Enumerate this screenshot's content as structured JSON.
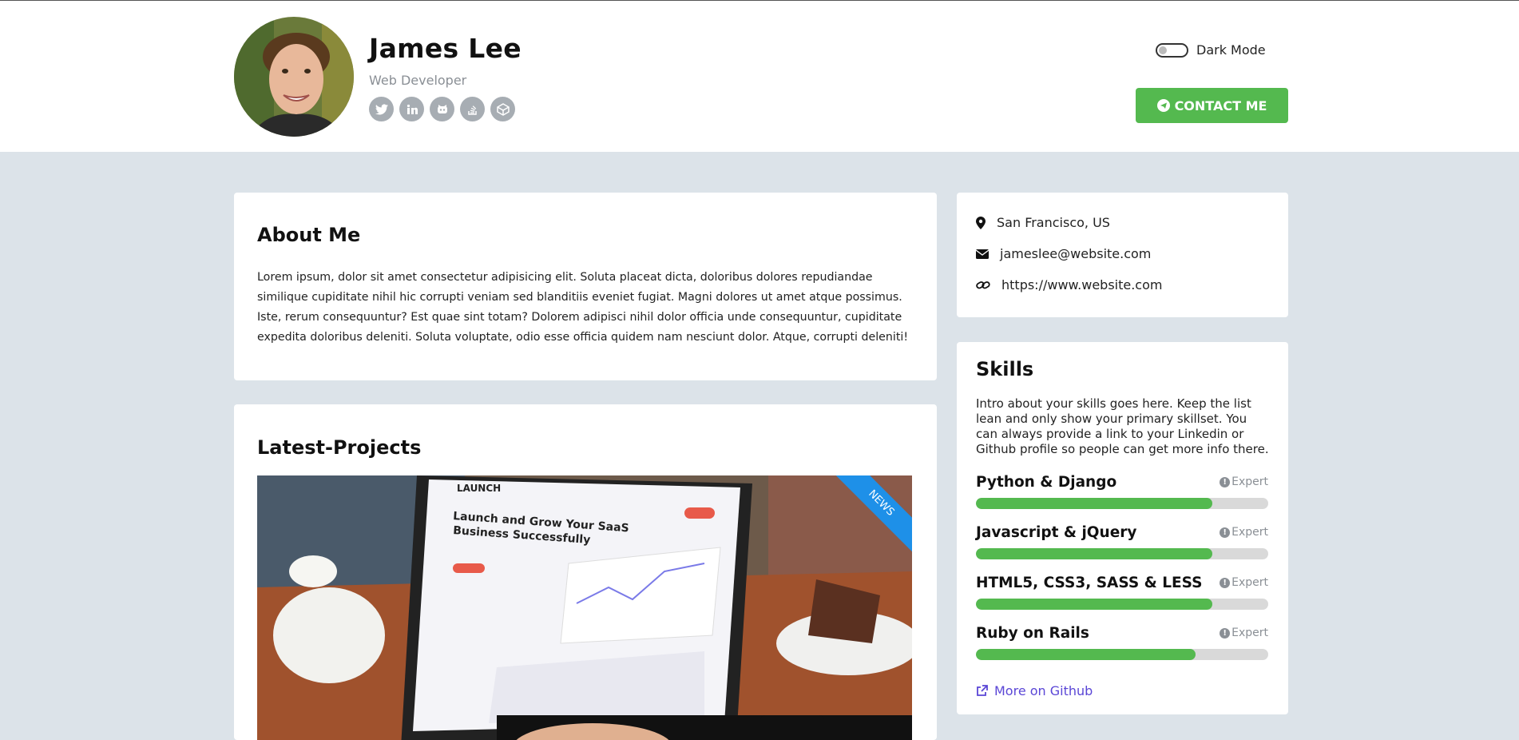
{
  "header": {
    "name": "James Lee",
    "role": "Web Developer",
    "socials": [
      "twitter-icon",
      "linkedin-icon",
      "github-icon",
      "stackoverflow-icon",
      "codepen-icon"
    ],
    "dark_mode_label": "Dark Mode",
    "dark_mode_on": false,
    "contact_label": "CONTACT ME"
  },
  "about": {
    "title": "About Me",
    "text": "Lorem ipsum, dolor sit amet consectetur adipisicing elit. Soluta placeat dicta, doloribus dolores repudiandae similique cupiditate nihil hic corrupti veniam sed blanditiis eveniet fugiat. Magni dolores ut amet atque possimus. Iste, rerum consequuntur? Est quae sint totam? Dolorem adipisci nihil dolor officia unde consequuntur, cupiditate expedita doloribus deleniti. Soluta voluptate, odio esse officia quidem nam nesciunt dolor. Atque, corrupti deleniti!"
  },
  "projects": {
    "title": "Latest-Projects",
    "ribbon": "NEWS",
    "screen": {
      "brand": "LAUNCH",
      "headline": "Launch and Grow Your SaaS Business Successfully"
    }
  },
  "contact_info": {
    "location": "San Francisco, US",
    "email": "jameslee@website.com",
    "website": "https://www.website.com"
  },
  "skills": {
    "title": "Skills",
    "intro": "Intro about your skills goes here. Keep the list lean and only show your primary skillset. You can always provide a link to your Linkedin or Github profile so people can get more info there.",
    "items": [
      {
        "name": "Python & Django",
        "level": "Expert",
        "progress": 0.81
      },
      {
        "name": "Javascript & jQuery",
        "level": "Expert",
        "progress": 0.81
      },
      {
        "name": "HTML5, CSS3, SASS & LESS",
        "level": "Expert",
        "progress": 0.81
      },
      {
        "name": "Ruby on Rails",
        "level": "Expert",
        "progress": 0.75
      }
    ],
    "more_link": "More on Github"
  },
  "colors": {
    "accent": "#54b94f",
    "ribbon": "#1e90e8",
    "link": "#5a46d6",
    "page_bg": "#dce3e9"
  }
}
